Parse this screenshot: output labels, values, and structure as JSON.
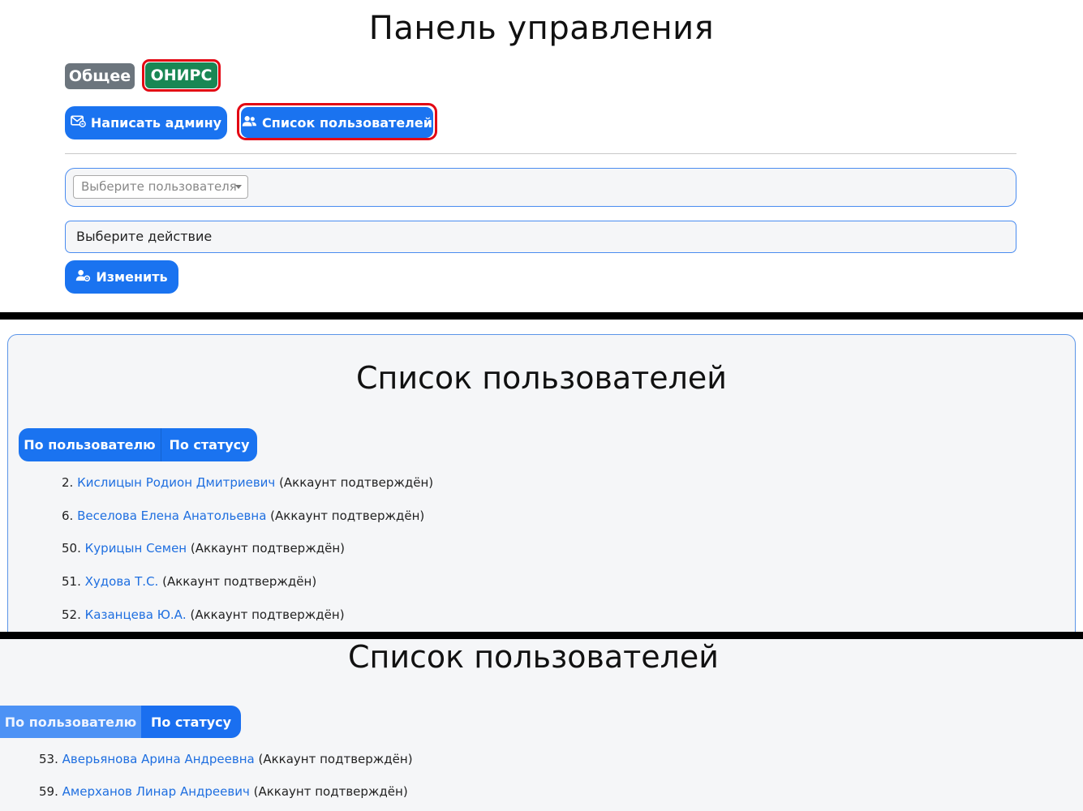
{
  "panel1": {
    "title": "Панель управления",
    "badges": {
      "general": "Общее",
      "onirs": "ОНИРС"
    },
    "buttons": {
      "write_admin": "Написать админу",
      "user_list": "Список пользователей",
      "change": "Изменить"
    },
    "user_select": {
      "placeholder": "Выберите пользователя"
    },
    "action_select": {
      "value": "Выберите действие"
    }
  },
  "panel2": {
    "title": "Список пользователей",
    "tabs": {
      "by_user": "По пользователю",
      "by_status": "По статусу"
    },
    "users": [
      {
        "num": "2.",
        "name": "Кислицын Родион Дмитриевич",
        "status": "(Аккаунт подтверждён)"
      },
      {
        "num": "6.",
        "name": "Веселова Елена Анатольевна",
        "status": "(Аккаунт подтверждён)"
      },
      {
        "num": "50.",
        "name": "Курицын Семен",
        "status": "(Аккаунт подтверждён)"
      },
      {
        "num": "51.",
        "name": "Худова Т.С.",
        "status": "(Аккаунт подтверждён)"
      },
      {
        "num": "52.",
        "name": "Казанцева Ю.А.",
        "status": "(Аккаунт подтверждён)"
      }
    ]
  },
  "panel3": {
    "title": "Список пользователей",
    "tabs": {
      "by_user": "По пользователю",
      "by_status": "По статусу"
    },
    "users": [
      {
        "num": "53.",
        "name": "Аверьянова Арина Андреевна",
        "status": "(Аккаунт подтверждён)"
      },
      {
        "num": "59.",
        "name": "Амерханов Линар Андреевич",
        "status": "(Аккаунт подтверждён)"
      }
    ]
  },
  "icons": {
    "write_admin": "envelope-icon",
    "user_list": "users-icon",
    "change": "user-gear-icon"
  },
  "colors": {
    "primary": "#1a73f0",
    "success": "#198754",
    "secondary": "#6c757d",
    "highlight": "#e30613",
    "link": "#1f6fe0"
  }
}
